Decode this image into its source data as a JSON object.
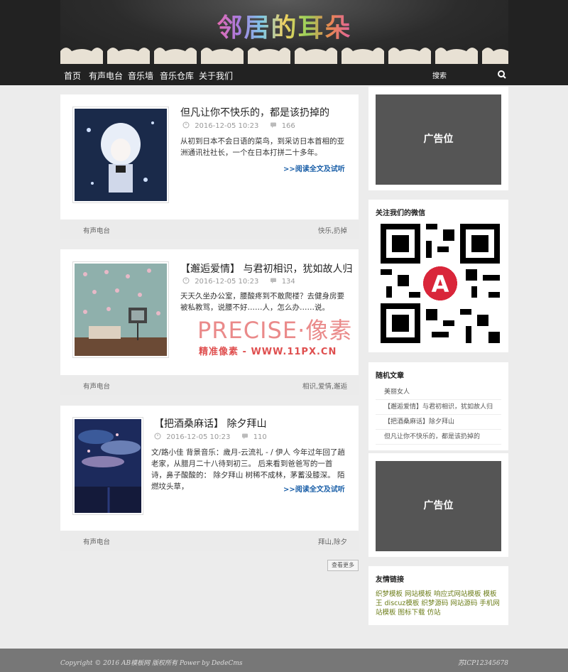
{
  "site": {
    "logo_text": "邻居的耳朵"
  },
  "nav": {
    "items": [
      "首页",
      "有声电台",
      "音乐墙",
      "音乐仓库",
      "关于我们"
    ]
  },
  "search": {
    "value": "搜索"
  },
  "posts": [
    {
      "title": "但凡让你不快乐的，都是该扔掉的",
      "date": "2016-12-05 10:23",
      "views": "166",
      "excerpt": "从初到日本不会日语的菜鸟，到采访日本首相的亚洲通讯社社长，一个在日本打拼二十多年。",
      "read_more": ">>阅读全文及试听",
      "category": "有声电台",
      "tags": "快乐,扔掉"
    },
    {
      "title": "【邂逅爱情】 与君初相识，犹如故人归",
      "date": "2016-12-05 10:23",
      "views": "134",
      "excerpt": "天天久坐办公室，腰酸疼到不敢爬楼？去健身房要被私教骂，说腰不好……人，怎么办……说。",
      "read_more": "",
      "category": "有声电台",
      "tags": "相识,爱情,邂逅"
    },
    {
      "title": "【把酒桑麻话】 除夕拜山",
      "date": "2016-12-05 10:23",
      "views": "110",
      "excerpt": "文/路小佳 背景音乐：歲月-云流礼 - / 伊人 今年过年回了趟老家，从腊月二十八待到初三。 后来看到爸爸写的一首诗，鼻子酸酸的： 除夕拜山 树稀不成林，茅蓄没膝深。 陌燃坟头草，",
      "read_more": ">>阅读全文及试听",
      "category": "有声电台",
      "tags": "拜山,除夕"
    }
  ],
  "load_more": "查看更多",
  "sidebar": {
    "ad_label": "广告位",
    "wechat_title": "关注我们的微信",
    "random_title": "随机文章",
    "random_items": [
      "美丽女人",
      "【邂逅爱情】与君初相识，犹如故人归",
      "【把酒桑麻话】除夕拜山",
      "但凡让你不快乐的，都是该扔掉的"
    ],
    "links_title": "友情链接",
    "links_text": "织梦模板 网站模板 响应式网站模板 模板王 discuz模板 织梦源码 网站源码 手机网站模板 图标下载 仿站"
  },
  "footer": {
    "copyright": "Copyright © 2016 AB模板网 版权所有 Power by DedeCms",
    "icp": "苏ICP12345678"
  },
  "watermark": {
    "brand": "PRECISE·像素",
    "sub": "精准像素 - WWW.11PX.CN"
  },
  "colors": {
    "header_bg": "#222222",
    "link_blue": "#1a5fa8",
    "ad_gray": "#555555",
    "links_olive": "#6d7e1a"
  }
}
